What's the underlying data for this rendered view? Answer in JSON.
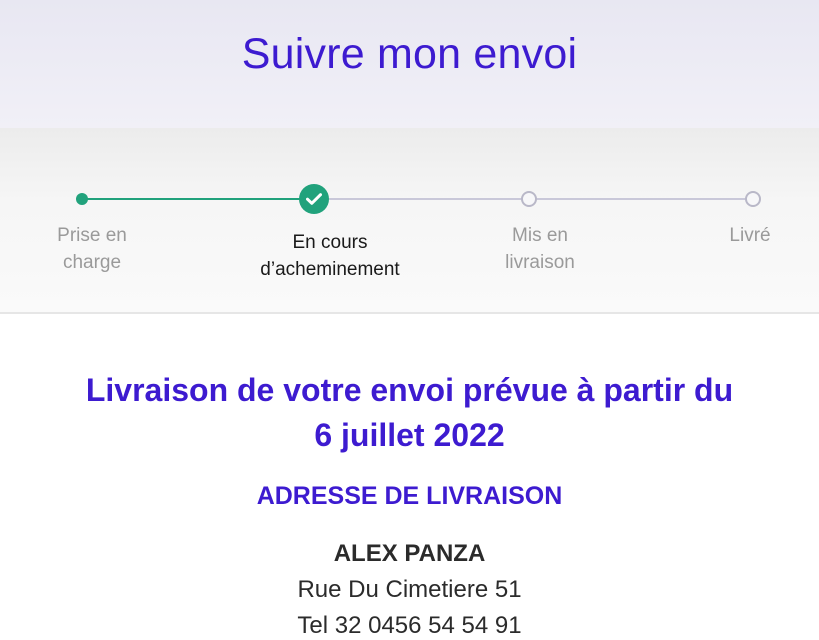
{
  "header": {
    "title": "Suivre mon envoi"
  },
  "tracker": {
    "steps": [
      {
        "label_line1": "Prise en",
        "label_line2": "charge",
        "state": "done"
      },
      {
        "label_line1": "En cours",
        "label_line2": "d’acheminement",
        "state": "current"
      },
      {
        "label_line1": "Mis en",
        "label_line2": "livraison",
        "state": "pending"
      },
      {
        "label_line1": "Livré",
        "label_line2": "",
        "state": "pending"
      }
    ],
    "colors": {
      "done": "#21a27c",
      "pending": "#c9c8d9"
    }
  },
  "delivery": {
    "message_line1": "Livraison de votre envoi prévue à partir du",
    "message_line2": "6 juillet 2022"
  },
  "address": {
    "heading": "ADRESSE DE LIVRAISON",
    "name": "ALEX PANZA",
    "street": "Rue Du Cimetiere 51",
    "phone": "Tel 32 0456 54 54 91"
  },
  "theme": {
    "accent": "#3d1bd0",
    "text": "#2b2b2b",
    "muted": "#9a9a9a"
  }
}
